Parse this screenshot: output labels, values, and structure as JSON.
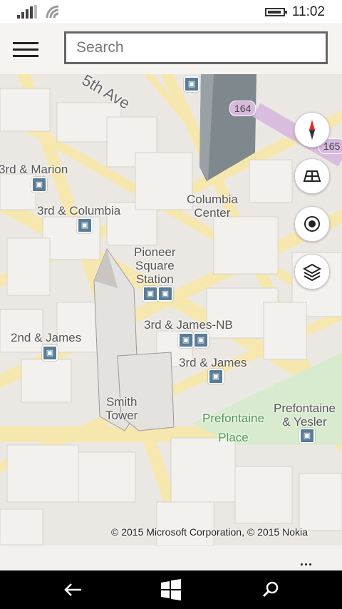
{
  "status_bar": {
    "time": "11:02"
  },
  "search": {
    "placeholder": "Search"
  },
  "map": {
    "labels": {
      "fifth_ave": "5th Ave",
      "third_marion": "3rd & Marion",
      "third_columbia": "3rd & Columbia",
      "columbia_center_1": "Columbia",
      "columbia_center_2": "Center",
      "pioneer_1": "Pioneer",
      "pioneer_2": "Square",
      "pioneer_3": "Station",
      "second_james": "2nd & James",
      "third_james_nb": "3rd & James-NB",
      "third_james": "3rd & James",
      "smith_1": "Smith",
      "smith_2": "Tower",
      "prefontaine_1": "Prefontaine",
      "prefontaine_2": "Place",
      "pref_yesler_1": "Prefontaine",
      "pref_yesler_2": "& Yesler"
    },
    "shields": [
      "164",
      "165"
    ],
    "copyright": "© 2015 Microsoft Corporation, © 2015 Nokia",
    "controls": [
      "compass-icon",
      "3d-view-icon",
      "locate-me-icon",
      "layers-icon"
    ]
  },
  "colors": {
    "road": "#f6e7ae",
    "building": "#f3f1ee",
    "park": "#d8ebcf",
    "transit": "#5a7d96",
    "highway": "#d7b8de"
  }
}
